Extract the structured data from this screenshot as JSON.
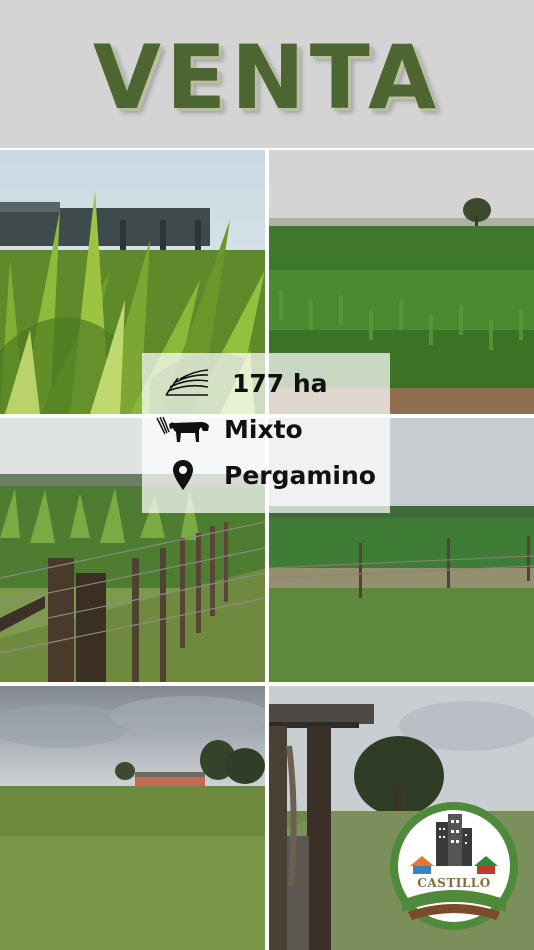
{
  "header": {
    "title": "VENTA"
  },
  "info": {
    "area": "177 ha",
    "type": "Mixto",
    "location": "Pergamino",
    "icons": [
      "field-rows-icon",
      "cow-icon",
      "location-pin-icon"
    ]
  },
  "logo": {
    "text": "CASTILLO",
    "icon": "buildings-houses-icon"
  },
  "colors": {
    "title": "#4d6530",
    "header_bg": "#d4d4d4",
    "logo_green": "#4f8a3b",
    "logo_brown": "#7b4a2a"
  }
}
